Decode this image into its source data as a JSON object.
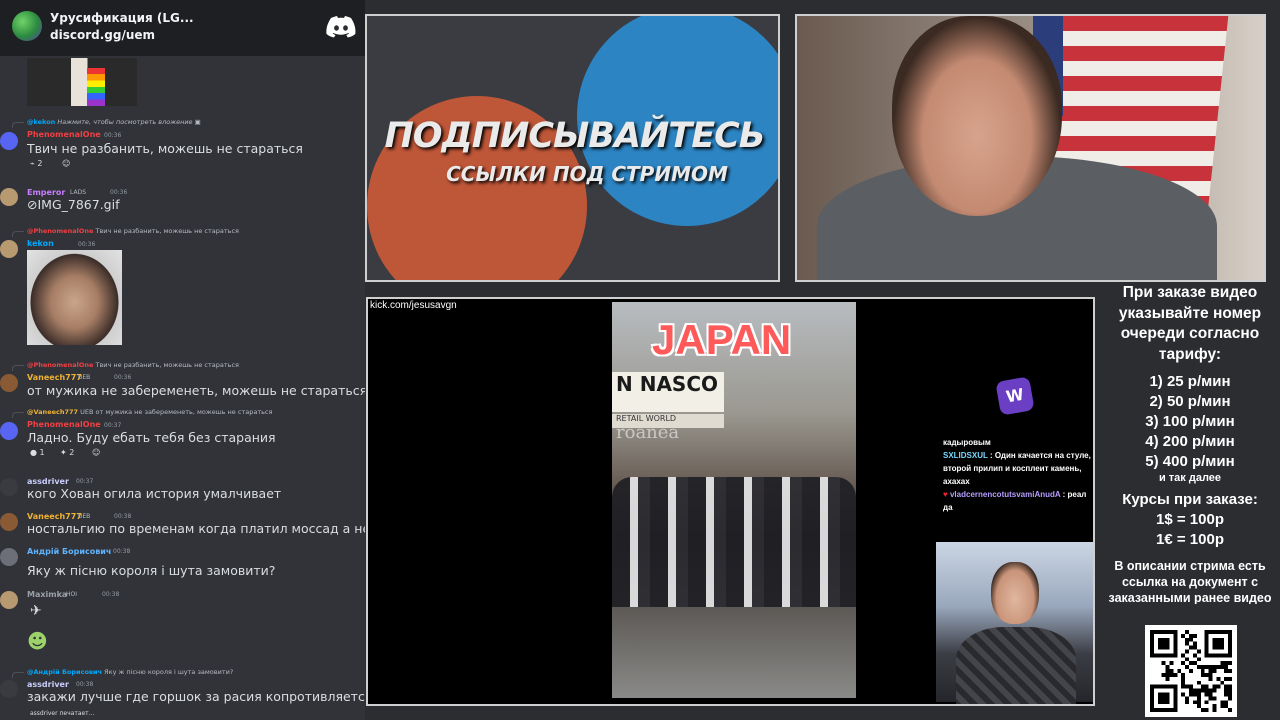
{
  "discord_header": {
    "server_title": "Урусификация (LG...",
    "invite": "discord.gg/uem"
  },
  "chat": {
    "m1": {
      "reply_name": "@kekon",
      "reply_text": "Нажмите, чтобы посмотреть вложение",
      "username": "PhenomenalOne",
      "time": "00:36",
      "text": "Твич не разбанить, можешь не стараться",
      "react_count": "2"
    },
    "m2": {
      "username": "Emperor",
      "badge": "LADS",
      "time": "00:36",
      "link": "IMG_7867.gif"
    },
    "m3": {
      "reply_name": "@PhenomenalOne",
      "reply_text": "Твич не разбанить, можешь не стараться",
      "username": "kekon",
      "time": "00:36"
    },
    "m4": {
      "reply_name": "@PhenomenalOne",
      "reply_text": "Твич не разбанить, можешь не стараться",
      "username": "Vaneech777",
      "badge": "UEB",
      "time": "00:36",
      "text": "от мужика не забеременеть, можешь не стараться"
    },
    "m5": {
      "reply_name": "@Vaneech777",
      "reply_badge": "UEB",
      "reply_text": "от мужика не забеременеть, можешь не стараться",
      "username": "PhenomenalOne",
      "time": "00:37",
      "text": "Ладно. Буду ебать тебя без старания",
      "react1": "1",
      "react2": "2"
    },
    "m6": {
      "username": "assdriver",
      "time": "00:37",
      "text": "кого Хован огила история умалчивает"
    },
    "m7": {
      "username": "Vaneech777",
      "badge": "UEB",
      "time": "00:38",
      "text": "ностальгию по временам когда платил моссад а не сбу"
    },
    "m8": {
      "username": "Андрій Борисович",
      "time": "00:38",
      "text": "Яку ж пісню короля і шута замовити?"
    },
    "m9": {
      "username": "Maximka",
      "badge": "HOI",
      "time": "00:38"
    },
    "m10": {
      "reply_name": "@Андрій Борисович",
      "reply_text": "Яку ж пісню короля і шута замовити?",
      "username": "assdriver",
      "time": "00:38",
      "text": "закажи лучше где горшок за расия копротивляется"
    },
    "typing": "assdriver печатает..."
  },
  "promo": {
    "title": "ПОДПИСЫВАЙТЕСЬ",
    "subtitle": "ССЫЛКИ ПОД СТРИМОМ"
  },
  "main_video": {
    "url": "kick.com/jesusavgn",
    "clip_title": "JAPAN",
    "shop_sign": "N NASCO",
    "shop_sub": "RETAIL   WORLD",
    "watermark": "roanea"
  },
  "overlay_chat": {
    "line0": "кадыровым",
    "name1": "SXLIDSXUL",
    "text1": "Один качается на стуле, второй прилип и косплеит камень, ахахах",
    "name2": "vladcernencotutsvamiAnudA",
    "text2": "реал да",
    "w_badge": "W"
  },
  "info": {
    "heading": "При заказе видео указывайте номер очереди согласно тарифу:",
    "prices": [
      "1) 25 р/мин",
      "2) 50 р/мин",
      "3) 100 р/мин",
      "4) 200 р/мин",
      "5) 400 р/мин"
    ],
    "more": "и так далее",
    "courses_title": "Курсы при заказе:",
    "rate_usd": "1$ = 100р",
    "rate_eur": "1€ = 100р",
    "footnote": "В описании стрима есть ссылка на документ с заказанными ранее видео"
  },
  "colors": {
    "discord_blurple": "#5865f2",
    "name_phenomenal": "#f23f43",
    "name_emperor": "#c77dff",
    "name_kekon": "#00a8fc",
    "name_vaneech": "#f0b232",
    "name_assdriver": "#c9cdfb",
    "name_andriy": "#5fb4ff",
    "name_maximka": "#9aa0a6"
  }
}
